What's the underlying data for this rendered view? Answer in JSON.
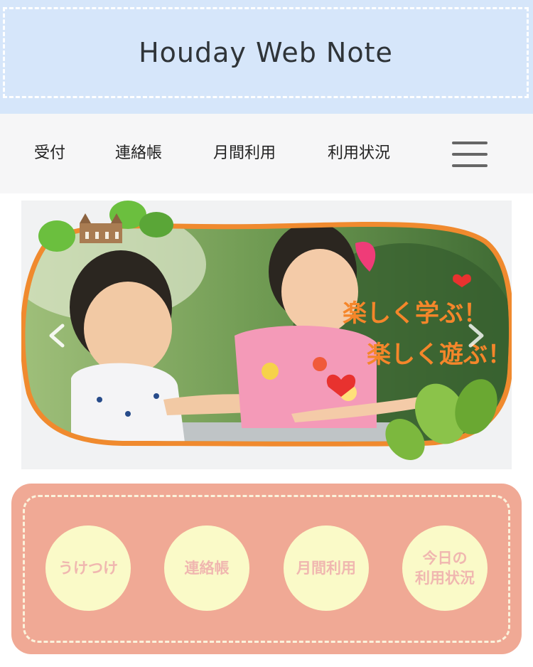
{
  "header": {
    "title": "Houday Web Note"
  },
  "nav": {
    "items": [
      {
        "label": "受付"
      },
      {
        "label": "連絡帳"
      },
      {
        "label": "月間利用"
      },
      {
        "label": "利用状況"
      }
    ],
    "menu_icon": "hamburger-icon"
  },
  "banner": {
    "tagline_line1": "楽しく学ぶ！",
    "tagline_line2": "楽しく遊ぶ！",
    "prev_icon": "chevron-left-icon",
    "next_icon": "chevron-right-icon"
  },
  "quick_menu": {
    "items": [
      {
        "label": "うけつけ"
      },
      {
        "label": "連絡帳"
      },
      {
        "label": "月間利用"
      },
      {
        "label": "今日の\n利用状況"
      }
    ]
  },
  "colors": {
    "header_bg": "#d6e6fa",
    "nav_bg": "#f6f6f7",
    "menu_bg": "#f0a995",
    "circle_bg": "#fafac8",
    "circle_text": "#f0b7b0"
  }
}
